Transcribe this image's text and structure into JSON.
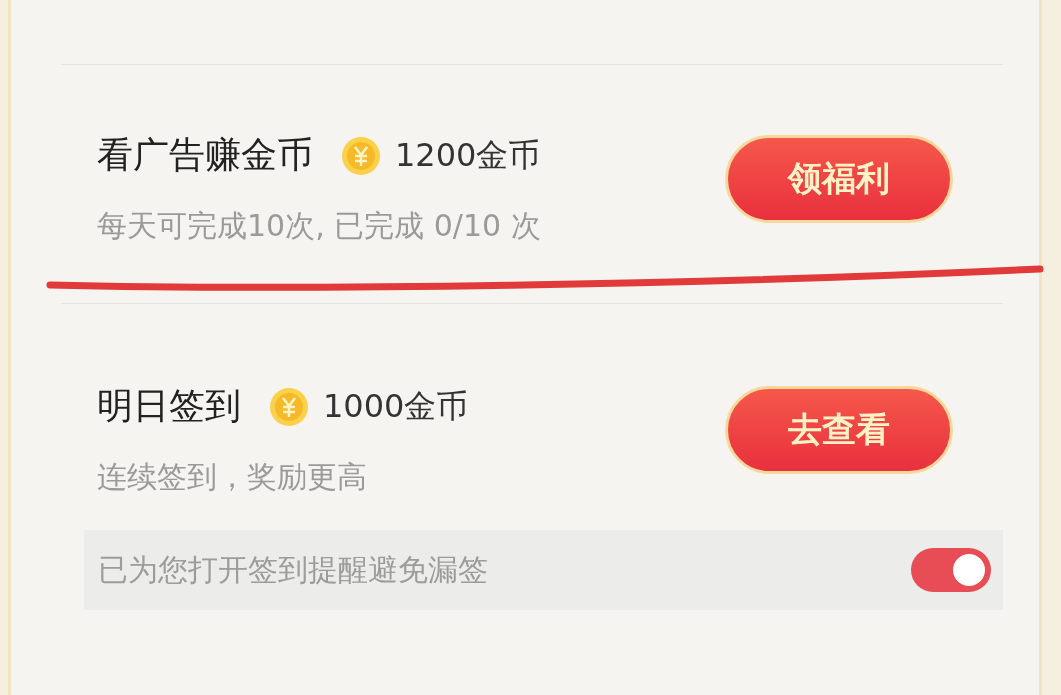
{
  "tasks": [
    {
      "title": "看广告赚金币",
      "reward": "1200金币",
      "subtitle": "每天可完成10次, 已完成 0/10 次",
      "button": "领福利"
    },
    {
      "title": "明日签到",
      "reward": "1000金币",
      "subtitle": "连续签到，奖励更高",
      "button": "去查看",
      "reminder": {
        "text": "已为您打开签到提醒避免漏签",
        "on": true
      }
    }
  ]
}
